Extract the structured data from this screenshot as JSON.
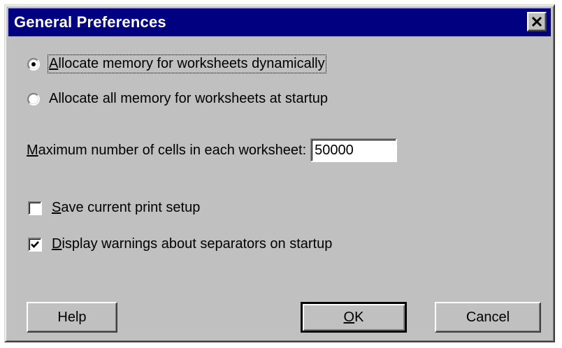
{
  "dialog": {
    "title": "General Preferences",
    "close_glyph": "✕"
  },
  "memory_options": [
    {
      "prefix": "A",
      "label": "llocate memory for worksheets dynamically",
      "selected": true
    },
    {
      "prefix": "",
      "label": "Allocate all memory for worksheets at startup",
      "selected": false
    }
  ],
  "max_cells": {
    "label_prefix": "M",
    "label_rest": "aximum number of cells in each worksheet:",
    "value": "50000"
  },
  "options": [
    {
      "prefix": "S",
      "label": "ave current print setup",
      "checked": false
    },
    {
      "prefix": "D",
      "label": "isplay warnings about separators on startup",
      "checked": true
    }
  ],
  "buttons": {
    "help": "Help",
    "ok_prefix": "O",
    "ok_rest": "K",
    "cancel": "Cancel"
  },
  "icons": {
    "close": "close-icon",
    "radio": "radio-icon",
    "checkbox": "checkbox-icon",
    "check": "checkmark-icon"
  }
}
